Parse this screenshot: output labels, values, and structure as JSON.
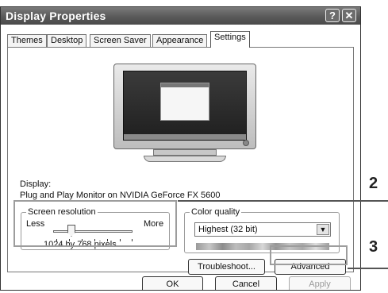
{
  "window": {
    "title": "Display Properties",
    "help_glyph": "?",
    "close_glyph": "✕"
  },
  "tabs": [
    {
      "label": "Themes"
    },
    {
      "label": "Desktop"
    },
    {
      "label": "Screen Saver"
    },
    {
      "label": "Appearance"
    },
    {
      "label": "Settings",
      "active": true
    }
  ],
  "display": {
    "label": "Display:",
    "device": "Plug and Play Monitor on NVIDIA GeForce FX 5600"
  },
  "screen_resolution": {
    "label": "Screen resolution",
    "less": "Less",
    "more": "More",
    "value": "1024 by 768 pixels",
    "slider_fraction": 0.2
  },
  "color_quality": {
    "label": "Color quality",
    "selected": "Highest (32 bit)",
    "dropdown_icon": "chevron-down-icon"
  },
  "buttons": {
    "troubleshoot": "Troubleshoot...",
    "advanced": "Advanced",
    "ok": "OK",
    "cancel": "Cancel",
    "apply": "Apply"
  },
  "callouts": {
    "two": "2",
    "three": "3"
  },
  "colors": {
    "highlight": "#9d9d9d",
    "titlebar": "#5a5a5a"
  }
}
